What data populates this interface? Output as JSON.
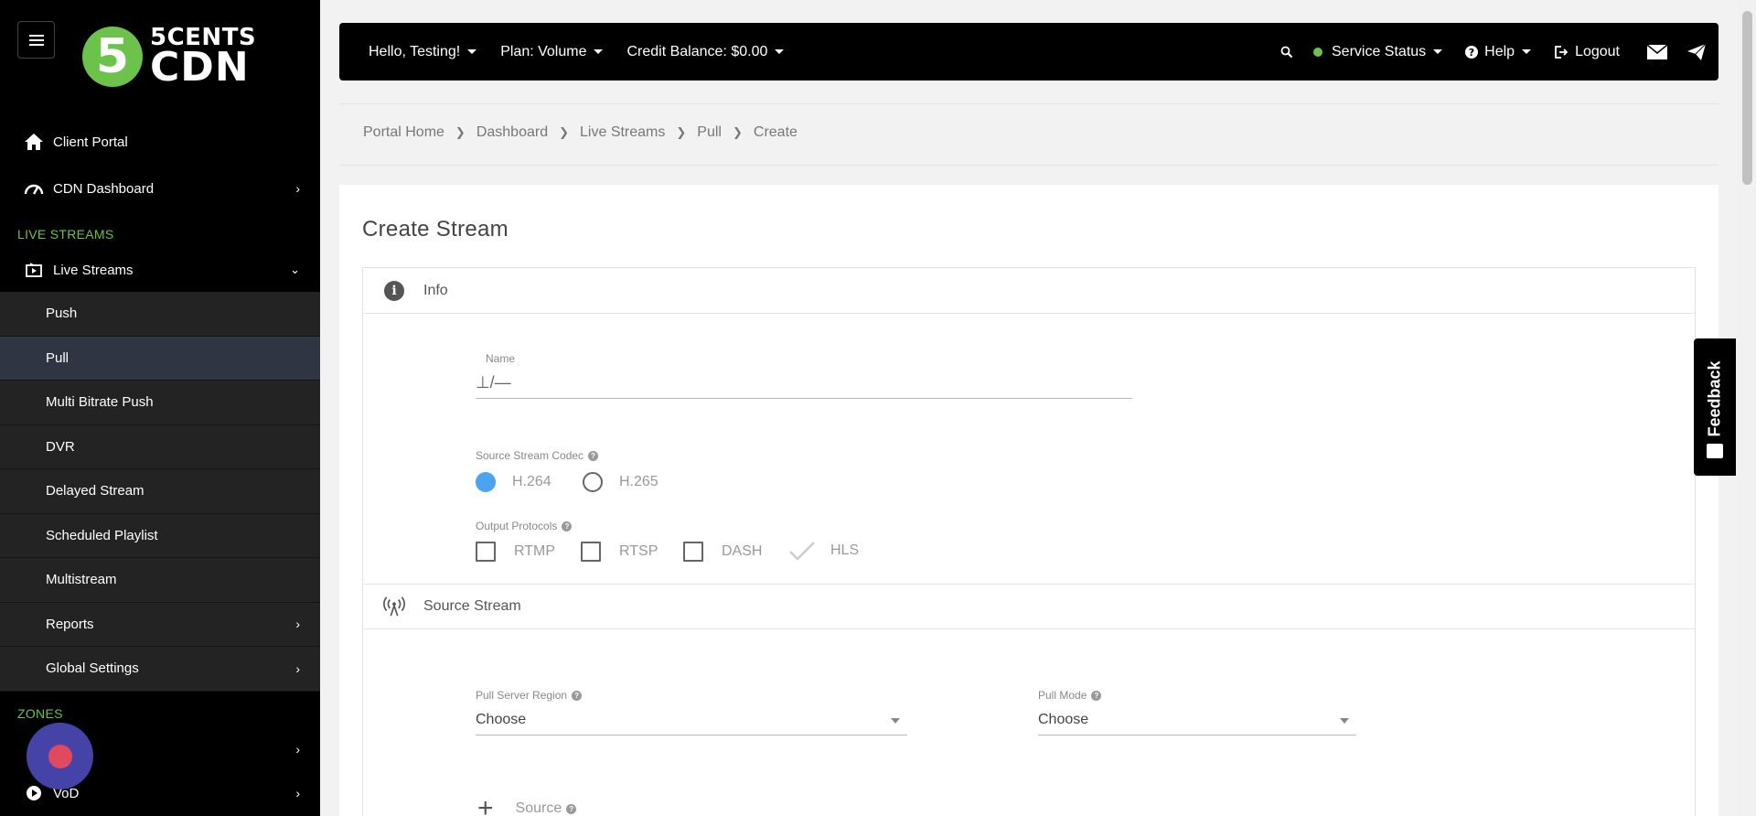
{
  "brand": {
    "logo_number": "5",
    "logo_line1": "5CENTS",
    "logo_line2": "CDN"
  },
  "sidebar": {
    "client_portal": "Client Portal",
    "cdn_dashboard": "CDN Dashboard",
    "section_live": "LIVE STREAMS",
    "live_streams": "Live Streams",
    "sub_items": [
      "Push",
      "Pull",
      "Multi Bitrate Push",
      "DVR",
      "Delayed Stream",
      "Scheduled Playlist",
      "Multistream",
      "Reports",
      "Global Settings"
    ],
    "active_sub": "Pull",
    "section_zones": "ZONES",
    "vod": "VoD"
  },
  "topbar": {
    "greeting": "Hello, Testing!",
    "plan": "Plan: Volume",
    "credit": "Credit Balance: $0.00",
    "service_status": "Service Status",
    "help": "Help",
    "logout": "Logout"
  },
  "breadcrumb": [
    "Portal Home",
    "Dashboard",
    "Live Streams",
    "Pull",
    "Create"
  ],
  "form": {
    "title": "Create Stream",
    "info_heading": "Info",
    "name_label": "Name",
    "name_value": "⊥/—",
    "codec_label": "Source Stream Codec",
    "codec_options": [
      "H.264",
      "H.265"
    ],
    "codec_selected": "H.264",
    "protocols_label": "Output Protocols",
    "protocols": [
      "RTMP",
      "RTSP",
      "DASH",
      "HLS"
    ],
    "source_heading": "Source Stream",
    "region_label": "Pull Server Region",
    "region_value": "Choose",
    "mode_label": "Pull Mode",
    "mode_value": "Choose",
    "source_label": "Source"
  },
  "feedback": {
    "label": "Feedback"
  },
  "colors": {
    "accent_green": "#6cc24a",
    "radio_blue": "#4aa4ef",
    "fab": "#4643a8"
  }
}
